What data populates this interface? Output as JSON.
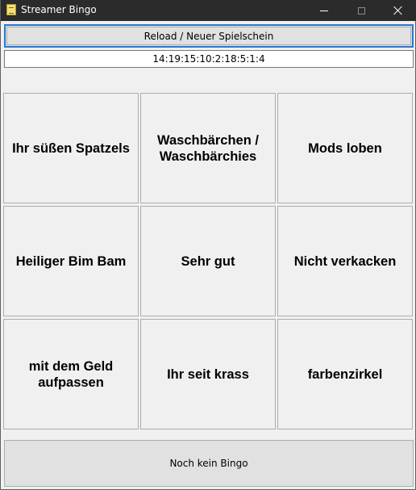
{
  "window": {
    "title": "Streamer Bingo",
    "icon": "bingo-app-icon",
    "controls": [
      "minimize-icon",
      "maximize-icon",
      "close-icon"
    ]
  },
  "reload_button": {
    "label": "Reload / Neuer Spielschein"
  },
  "seed": {
    "value": "14:19:15:10:2:18:5:1:4"
  },
  "bingo_cells": [
    "Ihr süßen Spatzels",
    "Waschbärchen / Waschbärchies",
    "Mods loben",
    "Heiliger Bim Bam",
    "Sehr gut",
    "Nicht verkacken",
    "mit dem Geld aufpassen",
    "Ihr seit krass",
    "farbenzirkel"
  ],
  "status": {
    "label": "Noch kein Bingo"
  },
  "colors": {
    "titlebar": "#2b2b2b",
    "focus_border": "#2a78d6",
    "window_bg": "#f0f0f0"
  }
}
